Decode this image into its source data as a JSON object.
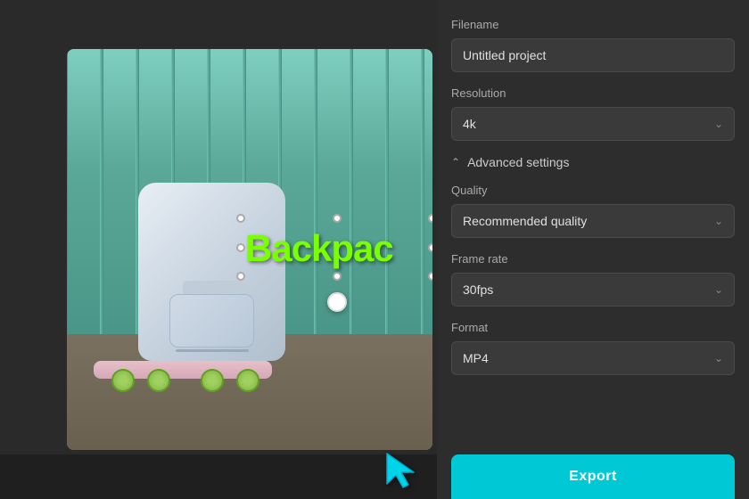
{
  "panel": {
    "filename_label": "Filename",
    "filename_value": "Untitled project",
    "filename_placeholder": "Untitled project",
    "resolution_label": "Resolution",
    "resolution_value": "4k",
    "advanced_label": "Advanced settings",
    "quality_label": "Quality",
    "quality_value": "Recommended quality",
    "framerate_label": "Frame rate",
    "framerate_value": "30fps",
    "format_label": "Format",
    "format_value": "MP4",
    "export_label": "Export"
  },
  "preview": {
    "text_overlay": "Backpac"
  },
  "icons": {
    "chevron_down": "⌄",
    "chevron_up": "^",
    "chevron_up_label": "collapse"
  }
}
